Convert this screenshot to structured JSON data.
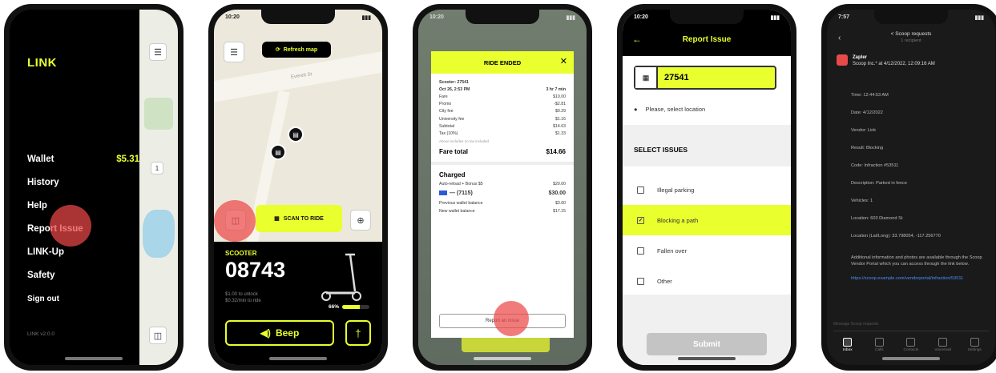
{
  "screens": {
    "menu": {
      "brand": "LINK",
      "items": [
        {
          "label": "Wallet",
          "value": "$5.31"
        },
        {
          "label": "History",
          "value": ""
        },
        {
          "label": "Help",
          "value": ""
        },
        {
          "label": "Report Issue",
          "value": ""
        },
        {
          "label": "LINK-Up",
          "value": ""
        },
        {
          "label": "Safety",
          "value": ""
        }
      ],
      "sign_out": "Sign out",
      "version": "LINK v2.0.0",
      "map_buttons": [
        "menu-icon",
        "zoom-icon",
        "support-icon"
      ]
    },
    "scooter": {
      "status_time": "10:20",
      "refresh_label": "Refresh map",
      "road_name": "Everett St",
      "scan_label": "SCAN TO RIDE",
      "scooter_label": "SCOOTER",
      "scooter_number": "08743",
      "price_line1": "$1.00 to unlock",
      "price_line2": "$0.32/min to ride",
      "battery_percent_label": "66%",
      "battery_level": 0.66,
      "beep_label": "Beep",
      "accent_color": "#e9ff2e"
    },
    "ride_ended": {
      "title": "RIDE ENDED",
      "rows": [
        {
          "label": "Scooter: 27541",
          "value": "",
          "bold": true
        },
        {
          "label": "Oct 26, 2:53 PM",
          "value": "3 hr 7 min",
          "bold": true
        },
        {
          "label": "Fare",
          "value": "$10.00",
          "bold": false
        },
        {
          "label": "Promo",
          "value": "-$2.81",
          "bold": false
        },
        {
          "label": "City fee",
          "value": "$0.29",
          "bold": false
        },
        {
          "label": "University fee",
          "value": "$1.16",
          "bold": false
        },
        {
          "label": "Subtotal",
          "value": "$14.63",
          "bold": false
        },
        {
          "label": "Tax (10%)",
          "value": "$1.33",
          "bold": false
        }
      ],
      "fine_print": "Above includes no tax included",
      "total_label": "Fare total",
      "total_value": "$14.66",
      "charged_title": "Charged",
      "charged_rows": [
        {
          "label": "Auto-reload + Bonus $5",
          "value": "$20.00",
          "big": false
        },
        {
          "label": "— (7115)",
          "value": "$30.00",
          "big": true
        },
        {
          "label": "Previous wallet balance",
          "value": "$3.60",
          "big": false
        },
        {
          "label": "New wallet balance",
          "value": "$17.15",
          "big": false
        }
      ],
      "report_label": "Report an issue"
    },
    "report": {
      "title": "Report Issue",
      "scooter_id": "27541",
      "location_placeholder": "Please, select location",
      "select_title": "SELECT ISSUES",
      "issues": [
        {
          "label": "Illegal parking",
          "checked": false
        },
        {
          "label": "Blocking a path",
          "checked": true
        },
        {
          "label": "Fallen over",
          "checked": false
        },
        {
          "label": "Other",
          "checked": false
        }
      ],
      "submit_label": "Submit"
    },
    "message": {
      "status_time": "7:57",
      "header_title": "< Scoop requests",
      "header_sub": "1 recipient",
      "sender_name": "Zapler",
      "sender_line": "Scoop Inc.* at 4/12/2022, 12:09:16 AM",
      "lines": [
        "Time: 12:44:53 AM",
        "Date: 4/12/2022",
        "Vendor: Link",
        "Result: Blocking",
        "Code: Infraction #53511",
        "Description: Parked in fence",
        "Vehicles: 1",
        "Location: 603 Diamond St",
        "Location (Lat/Long): 33.798054, -117.256770"
      ],
      "paragraph": "Additional information and photos are available through the Scoop Vendor Portal which you can access through the link below.",
      "link": "https://scoop.example.com/vendorportal/infraction/53511",
      "reply_placeholder": "Message Scoop requests",
      "tabs": [
        "Inbox",
        "Calls",
        "Contacts",
        "Voicemail",
        "Settings"
      ]
    }
  }
}
